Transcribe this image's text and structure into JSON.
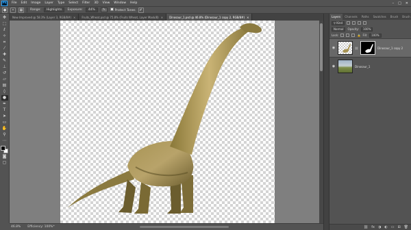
{
  "menu": {
    "logo": "Ps",
    "items": [
      "File",
      "Edit",
      "Image",
      "Layer",
      "Type",
      "Select",
      "Filter",
      "3D",
      "View",
      "Window",
      "Help"
    ]
  },
  "options_bar": {
    "range_label": "Range:",
    "range_value": "Highlights",
    "exposure_label": "Exposure:",
    "exposure_value": "44%",
    "protect_tones_label": "Protect Tones"
  },
  "document_tabs": [
    {
      "label": "New Improved @ 58.3% (Layer 3, RGB/8#)",
      "active": false
    },
    {
      "label": "Fruits_Wheat.psd @ 75.8% (Fruits Wheat, Layer Mask/8)",
      "active": false
    },
    {
      "label": "Dinosaur_1.psd @ 46.8% (Dinosaur_1 copy 2, RGB/8#)",
      "active": true
    }
  ],
  "status_bar": {
    "zoom": "46.8%",
    "doc_info": "Efficiency: 100%*"
  },
  "layers_panel": {
    "tabs": [
      "Layers",
      "Channels",
      "Paths",
      "Swatches",
      "Brush",
      "Brush Presets"
    ],
    "active_tab": "Layers",
    "kind_filter": "Kind",
    "blend_mode": "Normal",
    "opacity_label": "Opacity:",
    "opacity_value": "100%",
    "lock_label": "Lock:",
    "fill_label": "Fill:",
    "fill_value": "100%",
    "layers": [
      {
        "name": "Dinosaur_1 copy 2",
        "has_mask": true,
        "selected": true
      },
      {
        "name": "Dinosaur_1",
        "has_mask": false,
        "selected": false
      }
    ]
  },
  "colors": {
    "ui_bg": "#535353",
    "canvas_bg": "#7f7f7f",
    "accent": "#31a8ff"
  }
}
